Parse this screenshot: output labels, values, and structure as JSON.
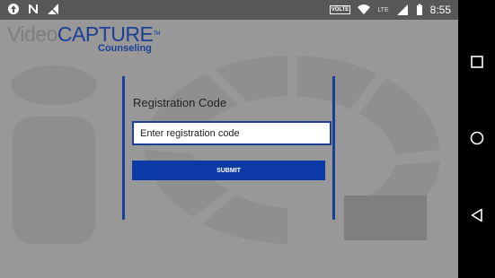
{
  "status_bar": {
    "left_icons": [
      "upload-icon",
      "notification-n-icon",
      "signal-off-icon"
    ],
    "volte": "VOLTE",
    "lte": "LTE",
    "time": "8:55"
  },
  "nav_bar": {
    "buttons": [
      "recent-apps-button",
      "home-button",
      "back-button"
    ]
  },
  "app": {
    "logo": {
      "video": "Video",
      "capture": "CAPTURE",
      "tm": "TM",
      "sub": "Counseling"
    },
    "form": {
      "label": "Registration Code",
      "input_value": "Enter registration code",
      "submit_label": "SUBMIT"
    }
  },
  "colors": {
    "accent": "#1c3f94",
    "button": "#0b3aa6",
    "background": "#989898",
    "status_bar": "#575757",
    "nav_bar": "#000000"
  }
}
